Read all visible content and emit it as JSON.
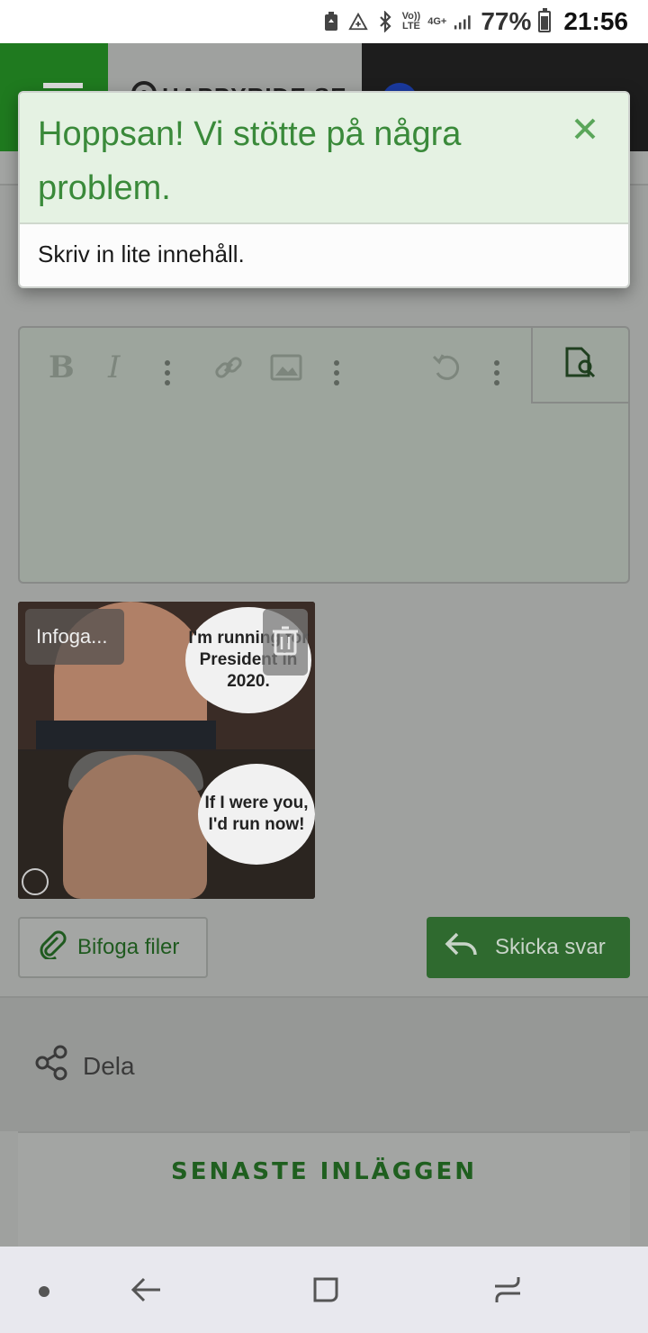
{
  "status_bar": {
    "lte_label": "Vo))\nLTE",
    "network": "4G+",
    "battery_percent": "77%",
    "battery_level": 0.77,
    "time": "21:56"
  },
  "header": {
    "logo_text": "HAPPYRIDE.SE"
  },
  "alert": {
    "title": "Hoppsan! Vi stötte på några problem.",
    "message": "Skriv in lite innehåll.",
    "close_icon": "close-icon",
    "accent_color": "#3a8a3a"
  },
  "editor": {
    "toolbar": {
      "bold_glyph": "B",
      "italic_glyph": "I"
    }
  },
  "attachment": {
    "label": "Infoga...",
    "bubble_top": "I'm running for President in 2020.",
    "bubble_bottom": "If I were you, I'd run now!"
  },
  "actions": {
    "attach_label": "Bifoga filer",
    "send_label": "Skicka svar"
  },
  "share": {
    "label": "Dela"
  },
  "latest": {
    "title": "SENASTE INLÄGGEN"
  },
  "colors": {
    "brand_green": "#1f7a1f",
    "send_button": "#2f6a2f"
  }
}
